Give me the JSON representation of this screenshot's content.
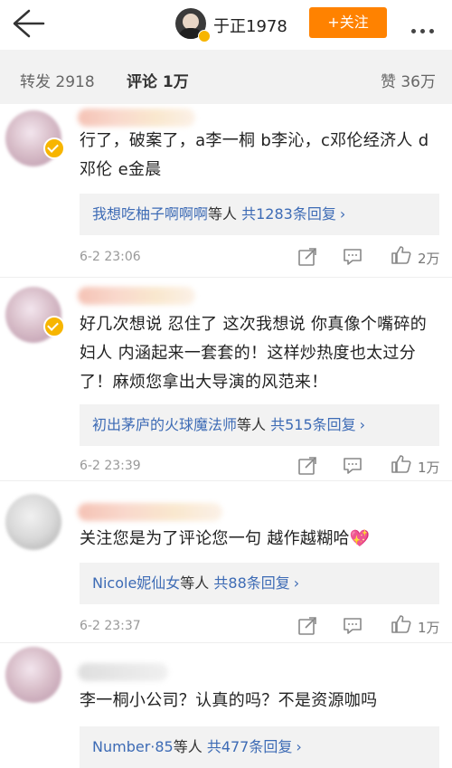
{
  "header": {
    "username": "于正1978",
    "follow_label": "+关注"
  },
  "tabs": {
    "repost": "转发 2918",
    "comment": "评论 1万",
    "like": "赞 36万"
  },
  "comments": [
    {
      "text": "行了，破案了，a李一桐 b李沁，c邓伦经济人 d 邓伦  e金晨",
      "reply_prefix": "我想吃柚子啊啊啊",
      "reply_mid": "等人 ",
      "reply_count": "共1283条回复",
      "time": "6-2 23:06",
      "likes": "2万"
    },
    {
      "text": "好几次想说 忍住了 这次我想说 你真像个嘴碎的妇人 内涵起来一套套的！这样炒热度也太过分了！麻烦您拿出大导演的风范来！",
      "reply_prefix": "初出茅庐的火球魔法师",
      "reply_mid": "等人 ",
      "reply_count": "共515条回复",
      "time": "6-2 23:39",
      "likes": "1万"
    },
    {
      "text": "关注您是为了评论您一句 越作越糊哈",
      "emoji": "💖",
      "reply_prefix": "Nicole妮仙女",
      "reply_mid": "等人 ",
      "reply_count": "共88条回复",
      "time": "6-2 23:37",
      "likes": "1万"
    },
    {
      "text": "李一桐小公司？认真的吗？不是资源咖吗",
      "reply_prefix": "Number·85",
      "reply_mid": "等人 ",
      "reply_count": "共477条回复"
    }
  ],
  "icons": {
    "back": "back-arrow-icon",
    "more": "more-dots-icon",
    "share": "share-icon",
    "comment": "comment-icon",
    "like": "thumbs-up-icon"
  },
  "colors": {
    "accent": "#ff8200",
    "link": "#3d6bb5",
    "verify": "#f7b500"
  }
}
